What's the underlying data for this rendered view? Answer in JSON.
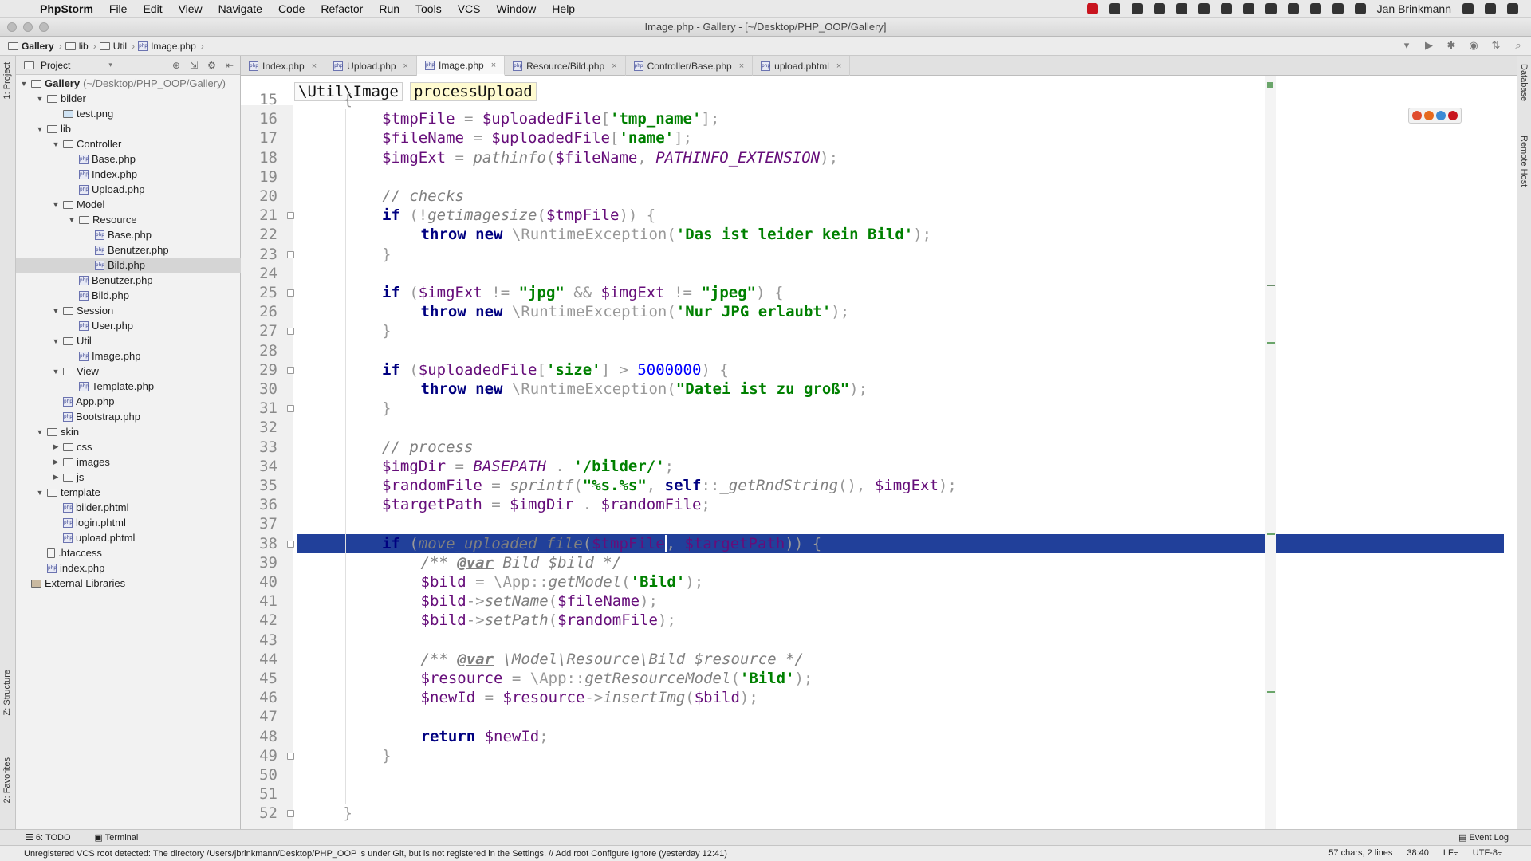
{
  "menubar": {
    "app_name": "PhpStorm",
    "items": [
      "File",
      "Edit",
      "View",
      "Navigate",
      "Code",
      "Refactor",
      "Run",
      "Tools",
      "VCS",
      "Window",
      "Help"
    ],
    "user": "Jan Brinkmann"
  },
  "window": {
    "title": "Image.php - Gallery - [~/Desktop/PHP_OOP/Gallery]"
  },
  "navbar": {
    "crumbs": [
      "Gallery",
      "lib",
      "Util",
      "Image.php"
    ]
  },
  "project": {
    "header": "Project",
    "tree": [
      {
        "label": "Gallery",
        "path": "(~/Desktop/PHP_OOP/Gallery)",
        "kind": "folder",
        "depth": 0,
        "open": true
      },
      {
        "label": "bilder",
        "kind": "folder",
        "depth": 1,
        "open": true
      },
      {
        "label": "test.png",
        "kind": "image",
        "depth": 2
      },
      {
        "label": "lib",
        "kind": "folder",
        "depth": 1,
        "open": true
      },
      {
        "label": "Controller",
        "kind": "folder",
        "depth": 2,
        "open": true
      },
      {
        "label": "Base.php",
        "kind": "php",
        "depth": 3
      },
      {
        "label": "Index.php",
        "kind": "php",
        "depth": 3
      },
      {
        "label": "Upload.php",
        "kind": "php",
        "depth": 3
      },
      {
        "label": "Model",
        "kind": "folder",
        "depth": 2,
        "open": true
      },
      {
        "label": "Resource",
        "kind": "folder",
        "depth": 3,
        "open": true
      },
      {
        "label": "Base.php",
        "kind": "php",
        "depth": 4
      },
      {
        "label": "Benutzer.php",
        "kind": "php",
        "depth": 4
      },
      {
        "label": "Bild.php",
        "kind": "php",
        "depth": 4,
        "selected": true
      },
      {
        "label": "Benutzer.php",
        "kind": "php",
        "depth": 3
      },
      {
        "label": "Bild.php",
        "kind": "php",
        "depth": 3
      },
      {
        "label": "Session",
        "kind": "folder",
        "depth": 2,
        "open": true
      },
      {
        "label": "User.php",
        "kind": "php",
        "depth": 3
      },
      {
        "label": "Util",
        "kind": "folder",
        "depth": 2,
        "open": true
      },
      {
        "label": "Image.php",
        "kind": "php",
        "depth": 3
      },
      {
        "label": "View",
        "kind": "folder",
        "depth": 2,
        "open": true
      },
      {
        "label": "Template.php",
        "kind": "php",
        "depth": 3
      },
      {
        "label": "App.php",
        "kind": "php",
        "depth": 2
      },
      {
        "label": "Bootstrap.php",
        "kind": "php",
        "depth": 2
      },
      {
        "label": "skin",
        "kind": "folder",
        "depth": 1,
        "open": true
      },
      {
        "label": "css",
        "kind": "folder",
        "depth": 2,
        "open": false
      },
      {
        "label": "images",
        "kind": "folder",
        "depth": 2,
        "open": false
      },
      {
        "label": "js",
        "kind": "folder",
        "depth": 2,
        "open": false
      },
      {
        "label": "template",
        "kind": "folder",
        "depth": 1,
        "open": true
      },
      {
        "label": "bilder.phtml",
        "kind": "php",
        "depth": 2
      },
      {
        "label": "login.phtml",
        "kind": "php",
        "depth": 2
      },
      {
        "label": "upload.phtml",
        "kind": "php",
        "depth": 2
      },
      {
        "label": ".htaccess",
        "kind": "file",
        "depth": 1
      },
      {
        "label": "index.php",
        "kind": "php",
        "depth": 1
      },
      {
        "label": "External Libraries",
        "kind": "lib",
        "depth": 0
      }
    ]
  },
  "tabs": [
    {
      "label": "Index.php",
      "active": false
    },
    {
      "label": "Upload.php",
      "active": false
    },
    {
      "label": "Image.php",
      "active": true
    },
    {
      "label": "Resource/Bild.php",
      "active": false
    },
    {
      "label": "Controller/Base.php",
      "active": false
    },
    {
      "label": "upload.phtml",
      "active": false
    }
  ],
  "editor": {
    "breadcrumb_class": "\\Util\\Image",
    "breadcrumb_method": "processUpload",
    "line_numbers": [
      "15",
      "16",
      "17",
      "18",
      "19",
      "20",
      "21",
      "22",
      "23",
      "24",
      "25",
      "26",
      "27",
      "28",
      "29",
      "30",
      "31",
      "32",
      "33",
      "34",
      "35",
      "36",
      "37",
      "38",
      "39",
      "40",
      "41",
      "42",
      "43",
      "44",
      "45",
      "46",
      "47",
      "48",
      "49",
      "50",
      "51",
      "52"
    ],
    "lines": [
      [
        [
          "p",
          "{"
        ]
      ],
      [
        [
          "v",
          "$tmpFile"
        ],
        [
          "p",
          " = "
        ],
        [
          "v",
          "$uploadedFile"
        ],
        [
          "p",
          "["
        ],
        [
          "s",
          "'tmp_name'"
        ],
        [
          "p",
          "];"
        ]
      ],
      [
        [
          "v",
          "$fileName"
        ],
        [
          "p",
          " = "
        ],
        [
          "v",
          "$uploadedFile"
        ],
        [
          "p",
          "["
        ],
        [
          "s",
          "'name'"
        ],
        [
          "p",
          "];"
        ]
      ],
      [
        [
          "v",
          "$imgExt"
        ],
        [
          "p",
          " = "
        ],
        [
          "f",
          "pathinfo"
        ],
        [
          "p",
          "("
        ],
        [
          "v",
          "$fileName"
        ],
        [
          "p",
          ", "
        ],
        [
          "cn",
          "PATHINFO_EXTENSION"
        ],
        [
          "p",
          ");"
        ]
      ],
      [],
      [
        [
          "c",
          "// checks"
        ]
      ],
      [
        [
          "k",
          "if"
        ],
        [
          "p",
          " (!"
        ],
        [
          "f",
          "getimagesize"
        ],
        [
          "p",
          "("
        ],
        [
          "v",
          "$tmpFile"
        ],
        [
          "p",
          ")) {"
        ]
      ],
      [
        [
          "k",
          "throw new"
        ],
        [
          "p",
          " \\RuntimeException("
        ],
        [
          "s",
          "'Das ist leider kein Bild'"
        ],
        [
          "p",
          ");"
        ]
      ],
      [
        [
          "p",
          "}"
        ]
      ],
      [],
      [
        [
          "k",
          "if"
        ],
        [
          "p",
          " ("
        ],
        [
          "v",
          "$imgExt"
        ],
        [
          "p",
          " != "
        ],
        [
          "s",
          "\"jpg\""
        ],
        [
          "p",
          " && "
        ],
        [
          "v",
          "$imgExt"
        ],
        [
          "p",
          " != "
        ],
        [
          "s",
          "\"jpeg\""
        ],
        [
          "p",
          ") {"
        ]
      ],
      [
        [
          "k",
          "throw new"
        ],
        [
          "p",
          " \\RuntimeException("
        ],
        [
          "s",
          "'Nur JPG erlaubt'"
        ],
        [
          "p",
          ");"
        ]
      ],
      [
        [
          "p",
          "}"
        ]
      ],
      [],
      [
        [
          "k",
          "if"
        ],
        [
          "p",
          " ("
        ],
        [
          "v",
          "$uploadedFile"
        ],
        [
          "p",
          "["
        ],
        [
          "s",
          "'size'"
        ],
        [
          "p",
          "] > "
        ],
        [
          "n",
          "5000000"
        ],
        [
          "p",
          ") {"
        ]
      ],
      [
        [
          "k",
          "throw new"
        ],
        [
          "p",
          " \\RuntimeException("
        ],
        [
          "s",
          "\"Datei ist zu groß\""
        ],
        [
          "p",
          ");"
        ]
      ],
      [
        [
          "p",
          "}"
        ]
      ],
      [],
      [
        [
          "c",
          "// process"
        ]
      ],
      [
        [
          "v",
          "$imgDir"
        ],
        [
          "p",
          " = "
        ],
        [
          "cn",
          "BASEPATH"
        ],
        [
          "p",
          " . "
        ],
        [
          "s",
          "'/bilder/'"
        ],
        [
          "p",
          ";"
        ]
      ],
      [
        [
          "v",
          "$randomFile"
        ],
        [
          "p",
          " = "
        ],
        [
          "f",
          "sprintf"
        ],
        [
          "p",
          "("
        ],
        [
          "s",
          "\"%s.%s\""
        ],
        [
          "p",
          ", "
        ],
        [
          "k",
          "self"
        ],
        [
          "p",
          "::"
        ],
        [
          "f",
          "_getRndString"
        ],
        [
          "p",
          "(), "
        ],
        [
          "v",
          "$imgExt"
        ],
        [
          "p",
          ");"
        ]
      ],
      [
        [
          "v",
          "$targetPath"
        ],
        [
          "p",
          " = "
        ],
        [
          "v",
          "$imgDir"
        ],
        [
          "p",
          " . "
        ],
        [
          "v",
          "$randomFile"
        ],
        [
          "p",
          ";"
        ]
      ],
      [],
      [
        [
          "k",
          "if"
        ],
        [
          "p",
          " ("
        ],
        [
          "f",
          "move_uploaded_file"
        ],
        [
          "p",
          "("
        ],
        [
          "v",
          "$tmpFile"
        ],
        [
          "p",
          ", "
        ],
        [
          "v",
          "$targetPath"
        ],
        [
          "p",
          ")) {"
        ]
      ],
      [
        [
          "dc",
          "/** "
        ],
        [
          "dt",
          "@var"
        ],
        [
          "dc",
          " Bild $bild */"
        ]
      ],
      [
        [
          "v",
          "$bild"
        ],
        [
          "p",
          " = \\App::"
        ],
        [
          "f",
          "getModel"
        ],
        [
          "p",
          "("
        ],
        [
          "s",
          "'Bild'"
        ],
        [
          "p",
          ");"
        ]
      ],
      [
        [
          "v",
          "$bild"
        ],
        [
          "p",
          "->"
        ],
        [
          "f",
          "setName"
        ],
        [
          "p",
          "("
        ],
        [
          "v",
          "$fileName"
        ],
        [
          "p",
          ");"
        ]
      ],
      [
        [
          "v",
          "$bild"
        ],
        [
          "p",
          "->"
        ],
        [
          "f",
          "setPath"
        ],
        [
          "p",
          "("
        ],
        [
          "v",
          "$randomFile"
        ],
        [
          "p",
          ");"
        ]
      ],
      [],
      [
        [
          "dc",
          "/** "
        ],
        [
          "dt",
          "@var"
        ],
        [
          "dc",
          " \\Model\\Resource\\Bild $resource */"
        ]
      ],
      [
        [
          "v",
          "$resource"
        ],
        [
          "p",
          " = \\App::"
        ],
        [
          "f",
          "getResourceModel"
        ],
        [
          "p",
          "("
        ],
        [
          "s",
          "'Bild'"
        ],
        [
          "p",
          ");"
        ]
      ],
      [
        [
          "v",
          "$newId"
        ],
        [
          "p",
          " = "
        ],
        [
          "v",
          "$resource"
        ],
        [
          "p",
          "->"
        ],
        [
          "f",
          "insertImg"
        ],
        [
          "p",
          "("
        ],
        [
          "v",
          "$bild"
        ],
        [
          "p",
          ");"
        ]
      ],
      [],
      [
        [
          "k",
          "return"
        ],
        [
          "p",
          " "
        ],
        [
          "v",
          "$newId"
        ],
        [
          "p",
          ";"
        ]
      ],
      [
        [
          "p",
          "}"
        ]
      ],
      [],
      [],
      [
        [
          "p",
          "}"
        ]
      ]
    ],
    "indent": [
      1,
      2,
      2,
      2,
      0,
      2,
      2,
      3,
      2,
      0,
      2,
      3,
      2,
      0,
      2,
      3,
      2,
      0,
      2,
      2,
      2,
      2,
      0,
      2,
      3,
      3,
      3,
      3,
      0,
      3,
      3,
      3,
      0,
      3,
      2,
      0,
      0,
      1
    ]
  },
  "leftstripe": {
    "top": "1: Project",
    "structure": "Z: Structure",
    "favorites": "2: Favorites"
  },
  "rightstripe": {
    "database": "Database",
    "remote": "Remote Host"
  },
  "bottombar": {
    "todo": "6: TODO",
    "terminal": "Terminal",
    "eventlog": "Event Log"
  },
  "statusbar": {
    "message": "Unregistered VCS root detected: The directory /Users/jbrinkmann/Desktop/PHP_OOP is under Git, but is not registered in the Settings. // Add root  Configure  Ignore (yesterday 12:41)",
    "selection": "57 chars, 2 lines",
    "position": "38:40",
    "line_sep": "LF÷",
    "encoding": "UTF-8÷"
  }
}
